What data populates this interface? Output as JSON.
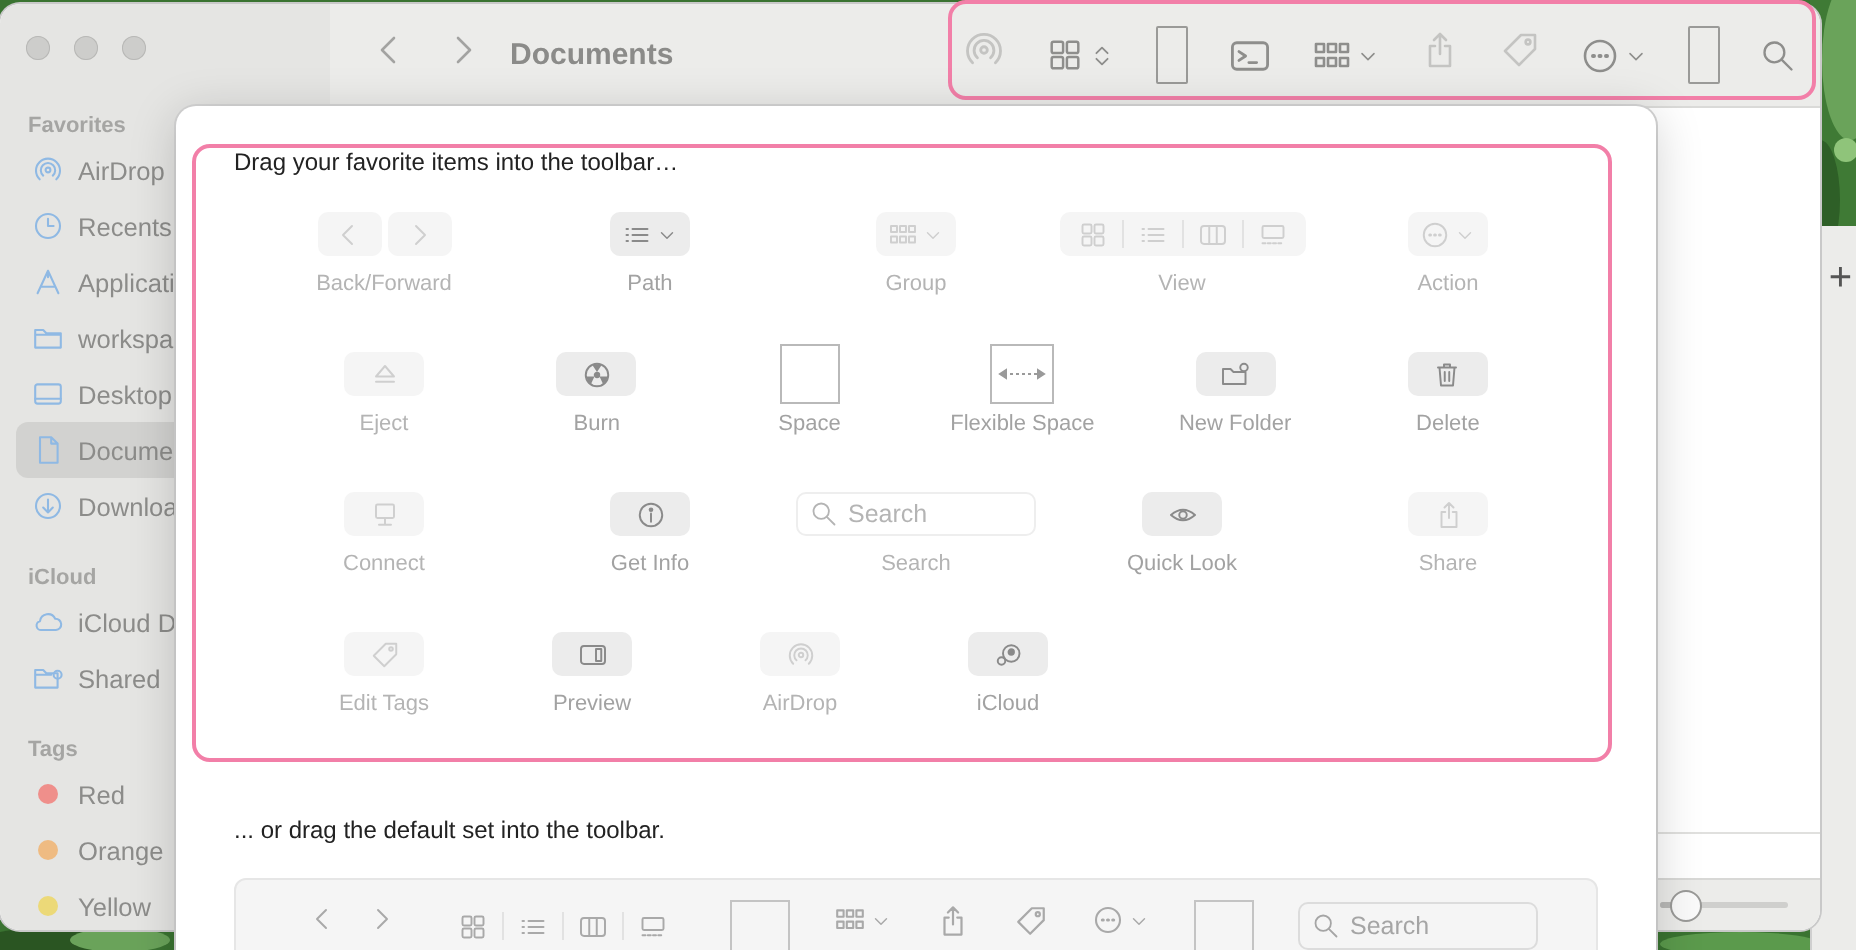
{
  "finder": {
    "title": "Documents",
    "sidebar": [
      {
        "heading": "Favorites",
        "items": [
          {
            "label": "AirDrop",
            "kind": "airdrop",
            "selected": false
          },
          {
            "label": "Recents",
            "kind": "clock",
            "selected": false
          },
          {
            "label": "Applicati",
            "kind": "apps",
            "selected": false
          },
          {
            "label": "workspa",
            "kind": "folder",
            "selected": false
          },
          {
            "label": "Desktop",
            "kind": "desktop",
            "selected": false
          },
          {
            "label": "Docume",
            "kind": "doc",
            "selected": true
          },
          {
            "label": "Downloa",
            "kind": "download",
            "selected": false
          }
        ]
      },
      {
        "heading": "iCloud",
        "items": [
          {
            "label": "iCloud D",
            "kind": "cloud",
            "selected": false
          },
          {
            "label": "Shared",
            "kind": "shared",
            "selected": false
          }
        ]
      },
      {
        "heading": "Tags",
        "items": [
          {
            "label": "Red",
            "kind": "tag",
            "color": "#ef8f8b",
            "selected": false
          },
          {
            "label": "Orange",
            "kind": "tag",
            "color": "#efbb82",
            "selected": false
          },
          {
            "label": "Yellow",
            "kind": "tag",
            "color": "#ecd978",
            "selected": false
          }
        ]
      }
    ],
    "zoom_slider": {
      "level": 0.2
    }
  },
  "background_window": {
    "button": "+"
  },
  "sheet": {
    "palette": {
      "heading": "Drag your favorite items into the toolbar…",
      "rows": [
        {
          "items": [
            {
              "label": "Back/Forward",
              "kind": "nav",
              "disabled": true
            },
            {
              "label": "Path",
              "kind": "path",
              "disabled": false
            },
            {
              "label": "Group",
              "kind": "group",
              "disabled": true
            },
            {
              "label": "View",
              "kind": "view",
              "disabled": true
            },
            {
              "label": "Action",
              "kind": "action",
              "disabled": true
            }
          ]
        },
        {
          "items": [
            {
              "label": "Eject",
              "kind": "eject",
              "disabled": true
            },
            {
              "label": "Burn",
              "kind": "burn",
              "disabled": false
            },
            {
              "label": "Space",
              "kind": "space",
              "disabled": false
            },
            {
              "label": "Flexible Space",
              "kind": "flexspace",
              "disabled": false
            },
            {
              "label": "New Folder",
              "kind": "newfolder",
              "disabled": false
            },
            {
              "label": "Delete",
              "kind": "delete",
              "disabled": false
            }
          ]
        },
        {
          "items": [
            {
              "label": "Connect",
              "kind": "connect",
              "disabled": true
            },
            {
              "label": "Get Info",
              "kind": "info",
              "disabled": false
            },
            {
              "label": "Search",
              "kind": "search",
              "placeholder": "Search",
              "disabled": true
            },
            {
              "label": "Quick Look",
              "kind": "quicklook",
              "disabled": false
            },
            {
              "label": "Share",
              "kind": "share",
              "disabled": true
            }
          ]
        },
        {
          "items": [
            {
              "label": "Edit Tags",
              "kind": "tag",
              "disabled": true
            },
            {
              "label": "Preview",
              "kind": "preview",
              "disabled": false
            },
            {
              "label": "AirDrop",
              "kind": "airdrop",
              "disabled": true
            },
            {
              "label": "iCloud",
              "kind": "icloud",
              "disabled": false
            }
          ]
        }
      ]
    },
    "default_set": {
      "caption": "... or drag the default set into the toolbar.",
      "items": [
        {
          "kind": "nav"
        },
        {
          "kind": "view"
        },
        {
          "kind": "space"
        },
        {
          "kind": "group"
        },
        {
          "kind": "share"
        },
        {
          "kind": "tag"
        },
        {
          "kind": "action"
        },
        {
          "kind": "space"
        },
        {
          "kind": "search",
          "placeholder": "Search"
        }
      ]
    }
  }
}
